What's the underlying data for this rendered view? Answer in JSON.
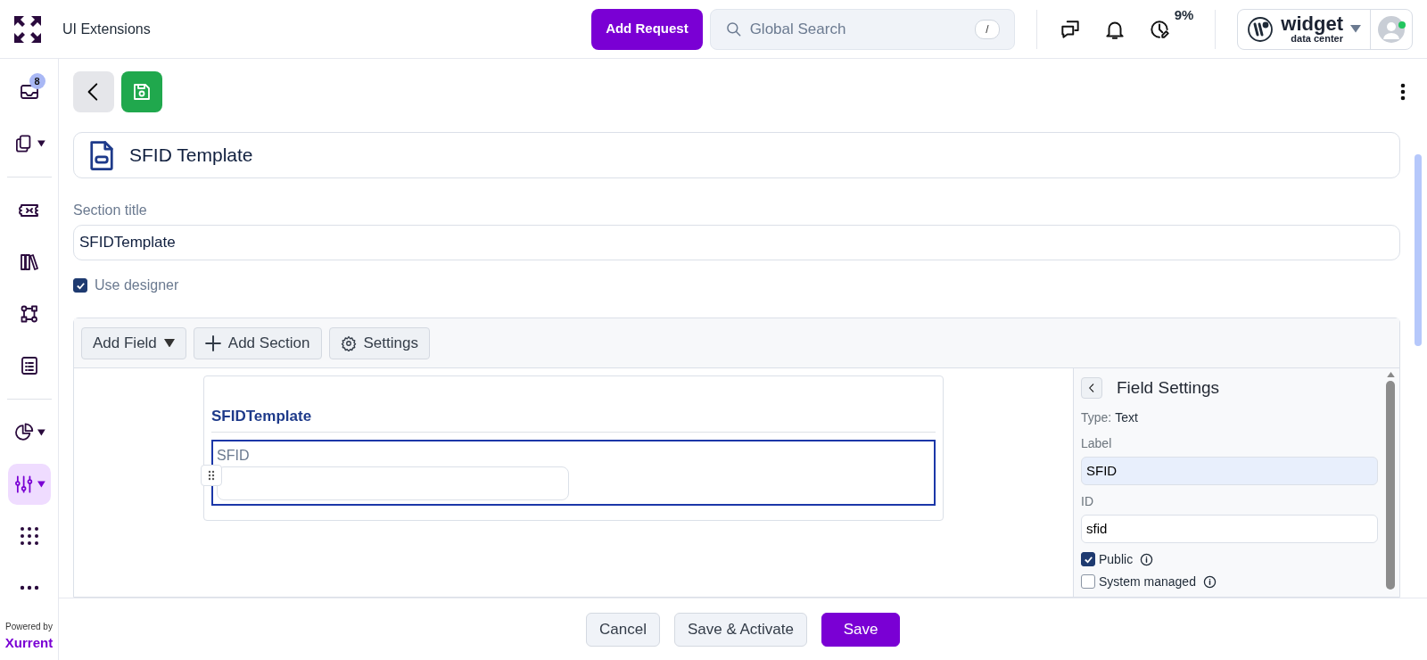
{
  "header": {
    "title": "UI Extensions",
    "add_request": "Add Request",
    "search": {
      "placeholder": "Global Search",
      "shortcut": "/"
    },
    "timer_percent": "9%",
    "brand": {
      "name": "widget",
      "subtitle": "data center"
    },
    "user_online": true
  },
  "sidebar": {
    "items": [
      {
        "kind": "inbox",
        "badge": "8",
        "dropdown": false,
        "selected": false
      },
      {
        "kind": "copy",
        "dropdown": true,
        "selected": false
      },
      {
        "kind": "divider"
      },
      {
        "kind": "ticket",
        "dropdown": false,
        "selected": false
      },
      {
        "kind": "books",
        "dropdown": false,
        "selected": false
      },
      {
        "kind": "workflow",
        "dropdown": false,
        "selected": false
      },
      {
        "kind": "list",
        "dropdown": false,
        "selected": false
      },
      {
        "kind": "divider"
      },
      {
        "kind": "pie",
        "dropdown": true,
        "selected": false
      },
      {
        "kind": "sliders",
        "dropdown": true,
        "selected": true
      },
      {
        "kind": "grid",
        "dropdown": false,
        "selected": false
      },
      {
        "kind": "more",
        "dropdown": false,
        "selected": false
      }
    ],
    "powered_by": "Powered by",
    "powered_brand": "Xurrent"
  },
  "form": {
    "name": "SFID Template",
    "section_title": {
      "label": "Section title",
      "value": "SFIDTemplate"
    },
    "use_designer": {
      "label": "Use designer",
      "checked": true
    }
  },
  "designer": {
    "toolbar": [
      {
        "kind": "dropdown",
        "label": "Add Field"
      },
      {
        "kind": "add",
        "label": "Add Section"
      },
      {
        "kind": "settings",
        "label": "Settings"
      }
    ],
    "canvas": {
      "section_title": "SFIDTemplate",
      "fields": [
        {
          "label": "SFID",
          "selected": true
        }
      ]
    },
    "field_settings": {
      "title": "Field Settings",
      "type_label": "Type:",
      "type_value": "Text",
      "fields": [
        {
          "label": "Label",
          "value": "SFID",
          "focused": true
        },
        {
          "label": "ID",
          "value": "sfid",
          "focused": false
        }
      ],
      "options": [
        {
          "label": "Public",
          "checked": true
        },
        {
          "label": "System managed",
          "checked": false
        }
      ]
    }
  },
  "footer": {
    "buttons": [
      {
        "kind": "secondary",
        "label": "Cancel"
      },
      {
        "kind": "secondary",
        "label": "Save & Activate"
      },
      {
        "kind": "primary",
        "label": "Save"
      }
    ]
  }
}
